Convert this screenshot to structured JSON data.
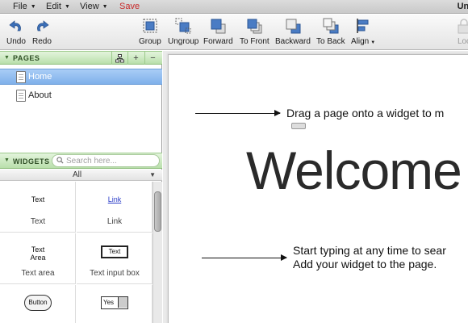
{
  "menubar": {
    "file": "File",
    "edit": "Edit",
    "view": "View",
    "save": "Save",
    "doc_title": "Unti"
  },
  "toolbar": {
    "undo": "Undo",
    "redo": "Redo",
    "group": "Group",
    "ungroup": "Ungroup",
    "forward": "Forward",
    "to_front": "To Front",
    "backward": "Backward",
    "to_back": "To Back",
    "align": "Align",
    "lock": "Loc"
  },
  "pages_panel": {
    "title": "PAGES",
    "add": "+",
    "remove": "−",
    "items": [
      {
        "label": "Home",
        "selected": true
      },
      {
        "label": "About",
        "selected": false
      }
    ]
  },
  "widgets_panel": {
    "title": "WIDGETS",
    "search_placeholder": "Search here...",
    "filter": "All",
    "items": [
      {
        "preview": "Text",
        "label": "Text"
      },
      {
        "preview": "Link",
        "label": "Link"
      },
      {
        "preview_line1": "Text",
        "preview_line2": "Area",
        "label": "Text area"
      },
      {
        "preview": "Text",
        "label": "Text input box"
      },
      {
        "preview": "Button",
        "label": ""
      },
      {
        "preview": "Yes",
        "label": ""
      }
    ]
  },
  "canvas": {
    "hint_drag": "Drag a page onto a widget to m",
    "heading": "Welcome",
    "hint_type_line1": "Start typing at any time to sear",
    "hint_type_line2": "Add your widget to the page."
  },
  "colors": {
    "save": "#c82a2a",
    "section_header": "#b9dfab",
    "selection": "#7fb0ea",
    "toolbar_icon": "#3b6fb8"
  }
}
